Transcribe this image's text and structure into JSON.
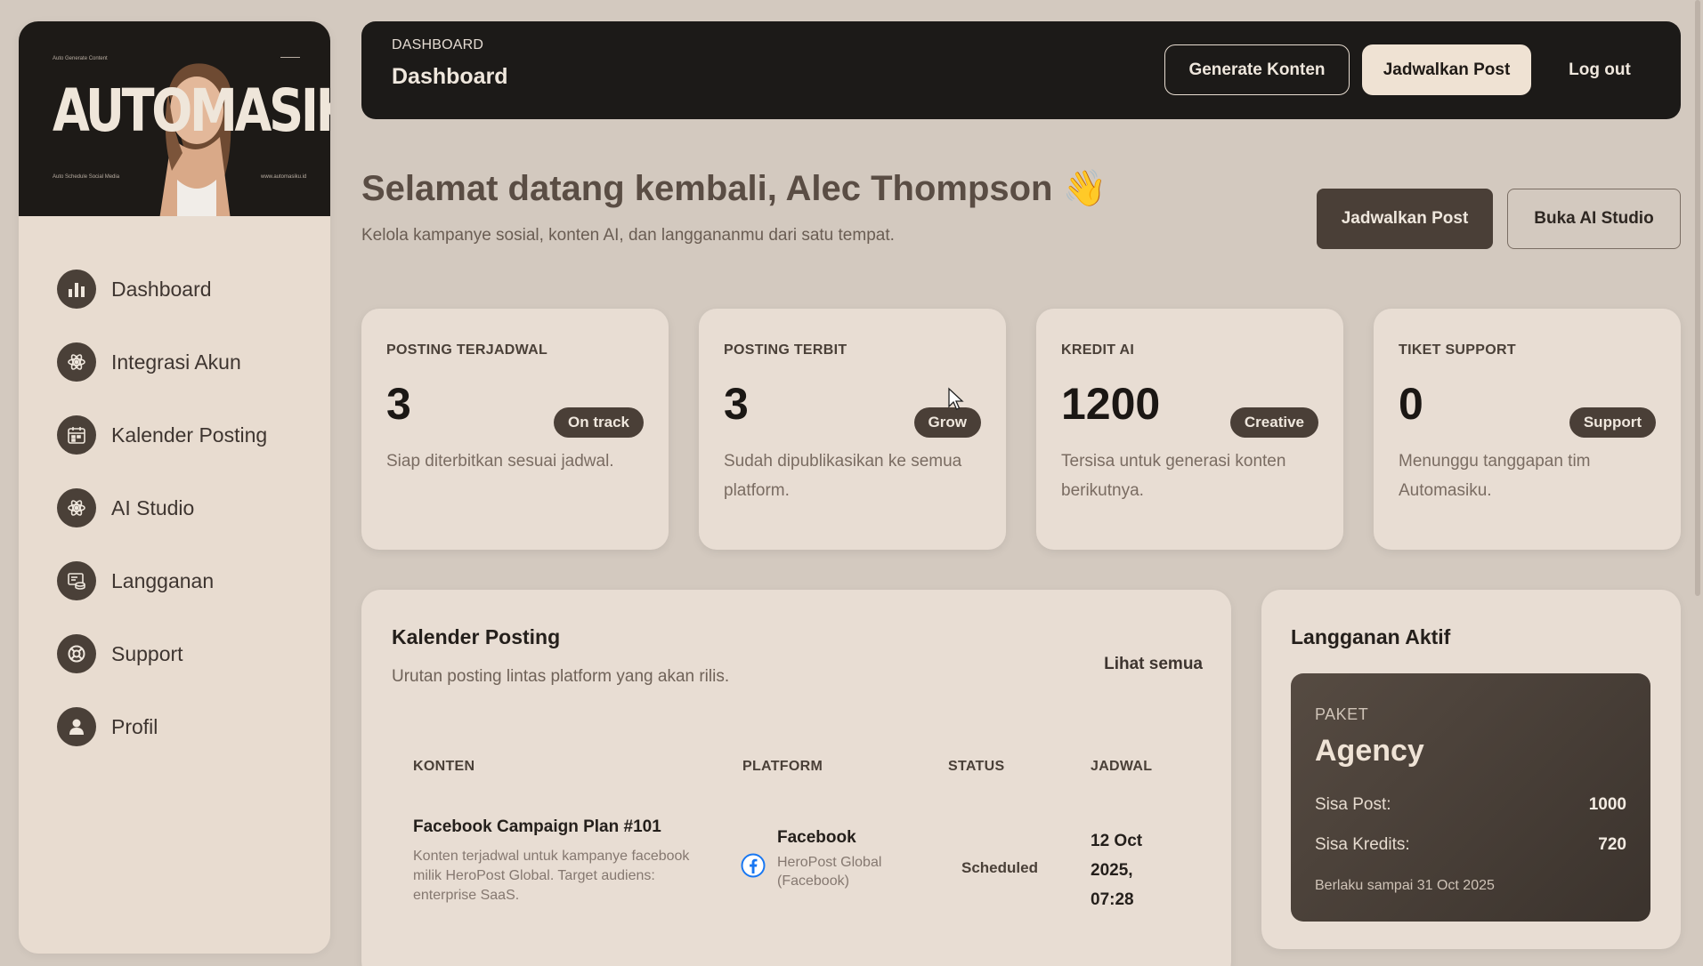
{
  "sidebar": {
    "brand": {
      "logo_text": "AUTOMASIKU",
      "tagline_top": "Auto Generate Content",
      "tagline_bottom": "Auto Schedule Social Media",
      "website": "www.automasiku.id"
    },
    "items": [
      {
        "label": "Dashboard",
        "icon": "bar-chart-icon"
      },
      {
        "label": "Integrasi Akun",
        "icon": "atom-icon"
      },
      {
        "label": "Kalender Posting",
        "icon": "calendar-icon"
      },
      {
        "label": "AI Studio",
        "icon": "atom-icon"
      },
      {
        "label": "Langganan",
        "icon": "subscription-icon"
      },
      {
        "label": "Support",
        "icon": "lifebuoy-icon"
      },
      {
        "label": "Profil",
        "icon": "user-icon"
      }
    ]
  },
  "header": {
    "breadcrumb": "DASHBOARD",
    "title": "Dashboard",
    "generate_label": "Generate Konten",
    "schedule_label": "Jadwalkan Post",
    "logout_label": "Log out"
  },
  "welcome": {
    "title": "Selamat datang kembali, Alec Thompson 👋",
    "subtitle": "Kelola kampanye sosial, konten AI, dan langgananmu dari satu tempat.",
    "primary_action": "Jadwalkan Post",
    "secondary_action": "Buka AI Studio"
  },
  "stats": [
    {
      "label": "POSTING TERJADWAL",
      "value": "3",
      "badge": "On track",
      "desc": "Siap diterbitkan sesuai jadwal."
    },
    {
      "label": "POSTING TERBIT",
      "value": "3",
      "badge": "Grow",
      "desc": "Sudah dipublikasikan ke semua platform."
    },
    {
      "label": "KREDIT AI",
      "value": "1200",
      "badge": "Creative",
      "desc": "Tersisa untuk generasi konten berikutnya."
    },
    {
      "label": "TIKET SUPPORT",
      "value": "0",
      "badge": "Support",
      "desc": "Menunggu tanggapan tim Automasiku."
    }
  ],
  "calendar": {
    "title": "Kalender Posting",
    "subtitle": "Urutan posting lintas platform yang akan rilis.",
    "see_all": "Lihat semua",
    "columns": [
      "KONTEN",
      "PLATFORM",
      "STATUS",
      "JADWAL"
    ],
    "rows": [
      {
        "title": "Facebook Campaign Plan #101",
        "desc": "Konten terjadwal untuk kampanye facebook milik HeroPost Global. Target audiens: enterprise SaaS.",
        "platform": "Facebook",
        "account": "HeroPost Global (Facebook)",
        "platform_icon": "facebook-icon",
        "status": "Scheduled",
        "date": "12 Oct 2025, 07:28"
      }
    ]
  },
  "subscription": {
    "title": "Langganan Aktif",
    "kicker": "PAKET",
    "plan": "Agency",
    "posts_label": "Sisa Post:",
    "posts_value": "1000",
    "credits_label": "Sisa Kredits:",
    "credits_value": "720",
    "valid_until": "Berlaku sampai 31 Oct 2025"
  },
  "colors": {
    "background": "#d3c9bf",
    "sidebar": "#e8dcd0",
    "dark": "#1c1a18",
    "accent_brown": "#4a3f37",
    "cream": "#efe2d3",
    "facebook": "#1877f2"
  }
}
